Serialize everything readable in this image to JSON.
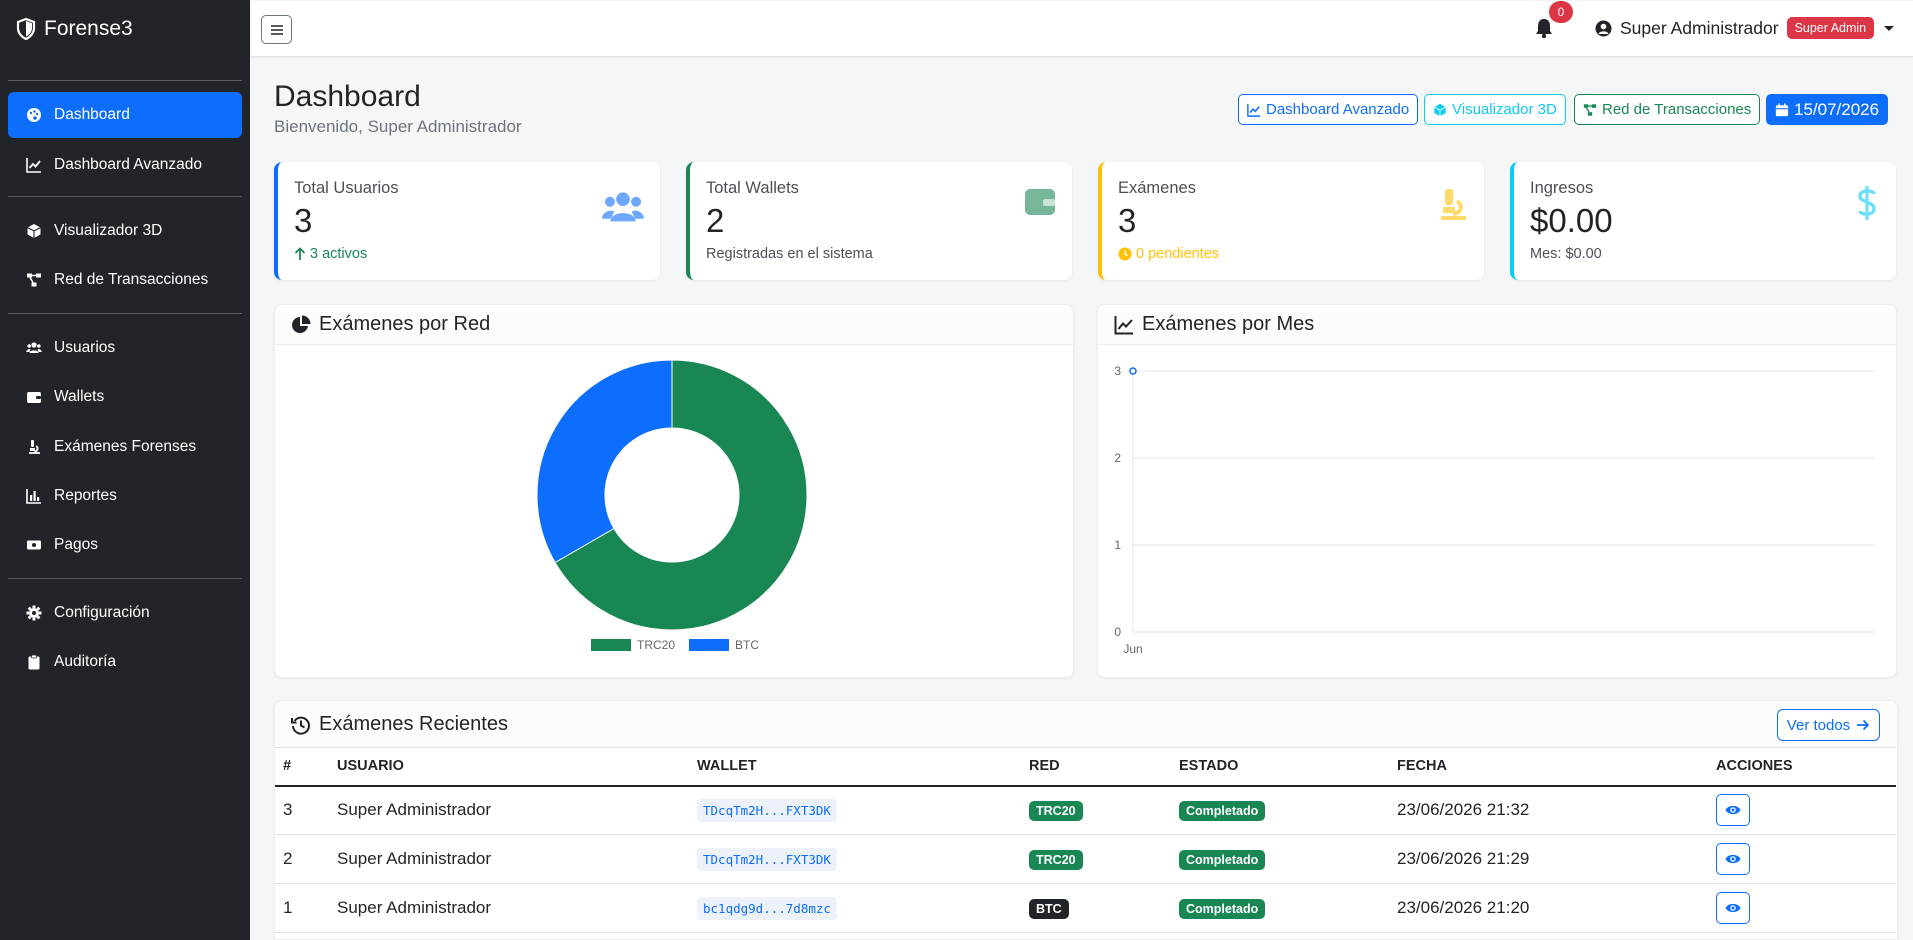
{
  "brand": {
    "name": "Forense3"
  },
  "sidebar": {
    "items": [
      {
        "label": "Dashboard",
        "icon": "palette-icon",
        "active": true
      },
      {
        "label": "Dashboard Avanzado",
        "icon": "chart-line-icon"
      },
      {
        "label": "Visualizador 3D",
        "icon": "cube-icon"
      },
      {
        "label": "Red de Transacciones",
        "icon": "network-icon"
      },
      {
        "label": "Usuarios",
        "icon": "users-icon"
      },
      {
        "label": "Wallets",
        "icon": "wallet-icon"
      },
      {
        "label": "Exámenes Forenses",
        "icon": "microscope-icon"
      },
      {
        "label": "Reportes",
        "icon": "bar-chart-icon"
      },
      {
        "label": "Pagos",
        "icon": "money-icon"
      },
      {
        "label": "Configuración",
        "icon": "gear-icon"
      },
      {
        "label": "Auditoría",
        "icon": "clipboard-icon"
      }
    ]
  },
  "topbar": {
    "notifications": "0",
    "user": "Super Administrador",
    "role": "Super Admin"
  },
  "page": {
    "title": "Dashboard",
    "subtitle": "Bienvenido, Super Administrador"
  },
  "actions": {
    "advanced": "Dashboard Avanzado",
    "viz3d": "Visualizador 3D",
    "network": "Red de Transacciones",
    "date": "15/07/2026"
  },
  "stats": [
    {
      "label": "Total Usuarios",
      "value": "3",
      "sub": "3 activos",
      "color": "#0d6efd"
    },
    {
      "label": "Total Wallets",
      "value": "2",
      "sub": "Registradas en el sistema",
      "color": "#198754"
    },
    {
      "label": "Exámenes",
      "value": "3",
      "sub": "0 pendientes",
      "color": "#ffc107"
    },
    {
      "label": "Ingresos",
      "value": "$0.00",
      "sub": "Mes: $0.00",
      "color": "#0dcaf0"
    }
  ],
  "pie_card": {
    "title": "Exámenes por Red"
  },
  "line_card": {
    "title": "Exámenes por Mes"
  },
  "chart_data": [
    {
      "type": "pie",
      "labels": [
        "TRC20",
        "BTC"
      ],
      "values": [
        2,
        1
      ],
      "colors": [
        "#198754",
        "#0d6efd"
      ],
      "legend": "bottom"
    },
    {
      "type": "line",
      "x": [
        "Jun"
      ],
      "series": [
        {
          "values": [
            3
          ],
          "color": "#0d6efd"
        }
      ],
      "ylim": [
        0,
        3
      ],
      "yticks": [
        0,
        1,
        2,
        3
      ],
      "grid": true
    }
  ],
  "recent": {
    "title": "Exámenes Recientes",
    "view_all": "Ver todos",
    "columns": [
      "#",
      "USUARIO",
      "WALLET",
      "RED",
      "ESTADO",
      "FECHA",
      "ACCIONES"
    ],
    "rows": [
      {
        "id": "3",
        "user": "Super Administrador",
        "wallet": "TDcqTm2H...FXT3DK",
        "net": "TRC20",
        "status": "Completado",
        "date": "23/06/2026 21:32"
      },
      {
        "id": "2",
        "user": "Super Administrador",
        "wallet": "TDcqTm2H...FXT3DK",
        "net": "TRC20",
        "status": "Completado",
        "date": "23/06/2026 21:29"
      },
      {
        "id": "1",
        "user": "Super Administrador",
        "wallet": "bc1qdg9d...7d8mzc",
        "net": "BTC",
        "status": "Completado",
        "date": "23/06/2026 21:20"
      }
    ]
  }
}
